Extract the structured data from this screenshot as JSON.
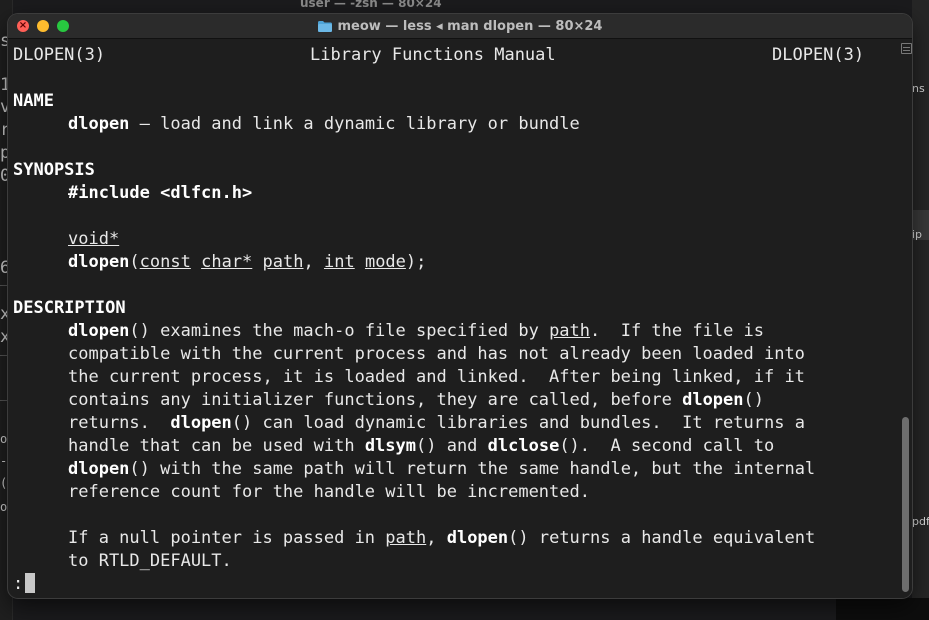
{
  "background": {
    "behind_title": "user — -zsh — 80×24",
    "left_fragments": [
      "s",
      "1",
      "v",
      "r",
      "p",
      "0",
      "6",
      "x",
      "x"
    ],
    "left_fragments_lower": [
      "ou",
      "-(",
      "ou"
    ],
    "right_fragments": [
      "ns",
      "ip",
      "pdf"
    ]
  },
  "window": {
    "title": "meow — less ◂ man dlopen — 80×24",
    "title_icon": "folder-icon",
    "traffic_lights": {
      "close": "#ff5f57",
      "minimize": "#febc2e",
      "zoom": "#28c840"
    }
  },
  "man": {
    "header": {
      "left": "DLOPEN(3)",
      "center": "Library Functions Manual",
      "right": "DLOPEN(3)"
    },
    "name_heading": "NAME",
    "name_cmd": "dlopen",
    "name_desc": " – load and link a dynamic library or bundle",
    "synopsis_heading": "SYNOPSIS",
    "include": "#include <dlfcn.h>",
    "ret_type": "void*",
    "sig_fn": "dlopen",
    "sig_p1": "(",
    "sig_const": "const",
    "sig_sp1": " ",
    "sig_char": "char*",
    "sig_sp2": " ",
    "sig_path": "path",
    "sig_comma": ", ",
    "sig_int": "int",
    "sig_sp3": " ",
    "sig_mode": "mode",
    "sig_end": ");",
    "description_heading": "DESCRIPTION",
    "d1a": "dlopen",
    "d1b": "() examines the mach-o file specified by ",
    "d1c": "path",
    "d1d": ".  If the file is",
    "d2": "compatible with the current process and has not already been loaded into",
    "d3": "the current process, it is loaded and linked.  After being linked, if it",
    "d4a": "contains any initializer functions, they are called, before ",
    "d4b": "dlopen",
    "d4c": "()",
    "d5a": "returns.  ",
    "d5b": "dlopen",
    "d5c": "() can load dynamic libraries and bundles.  It returns a",
    "d6a": "handle that can be used with ",
    "d6b": "dlsym",
    "d6c": "() and ",
    "d6d": "dlclose",
    "d6e": "().  A second call to",
    "d7a": "dlopen",
    "d7b": "() with the same path will return the same handle, but the internal",
    "d8": "reference count for the handle will be incremented.",
    "p2a": "If a null pointer is passed in ",
    "p2b": "path",
    "p2c": ", ",
    "p2d": "dlopen",
    "p2e": "() returns a handle equivalent",
    "p2f": "to RTLD_DEFAULT.",
    "prompt": ":"
  }
}
